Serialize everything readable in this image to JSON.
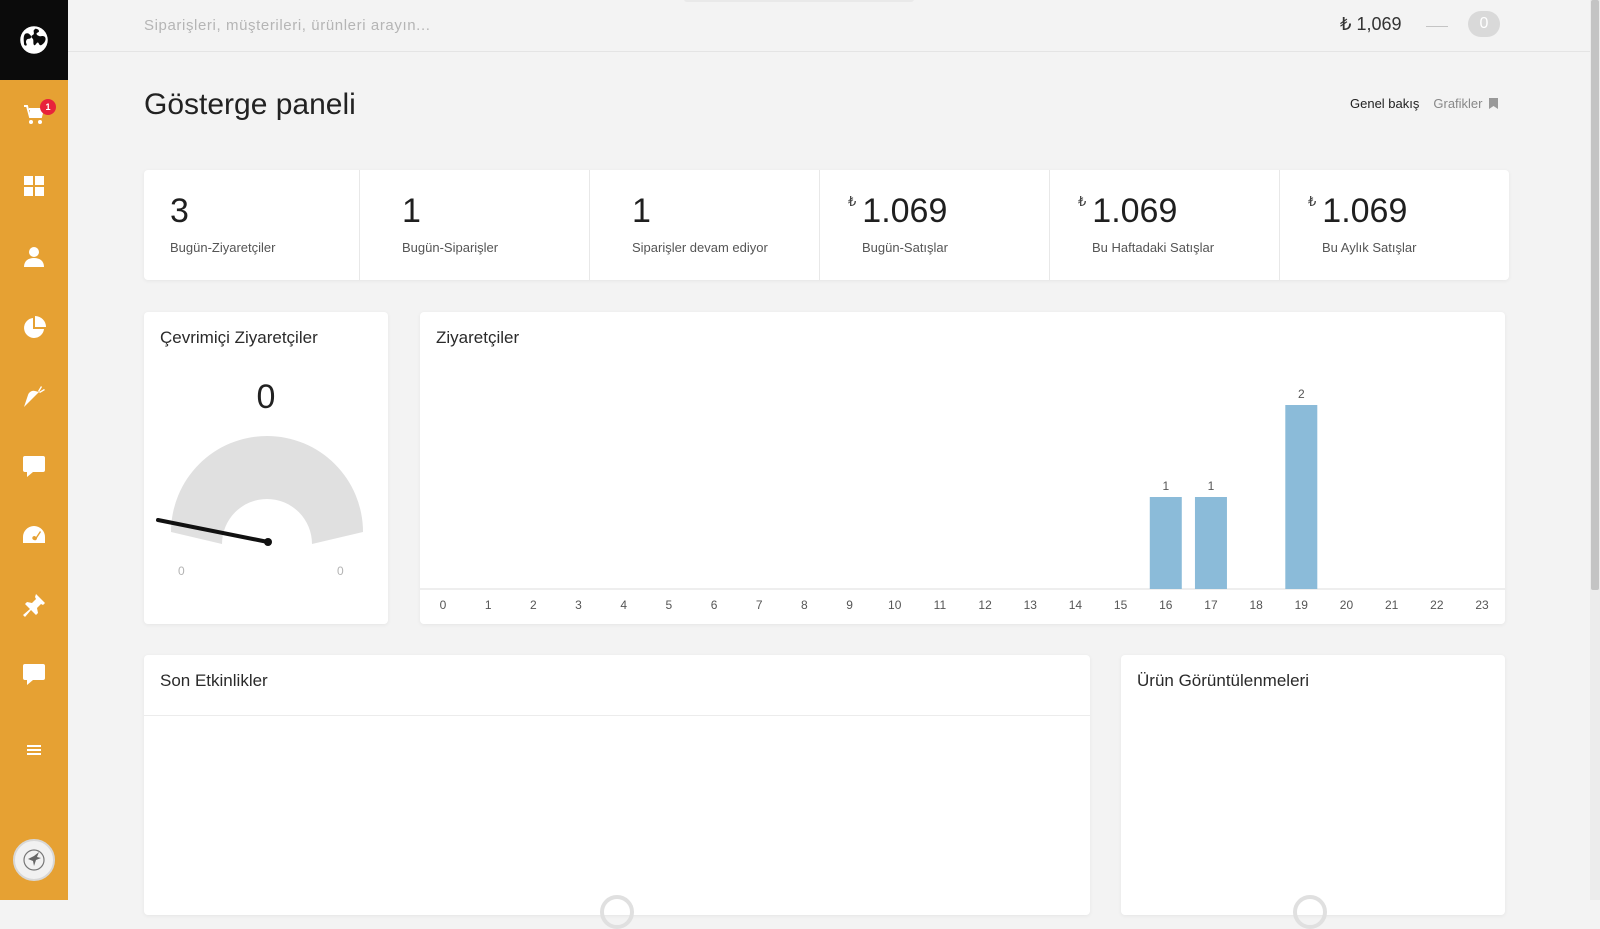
{
  "sidebar": {
    "cart_badge": "1",
    "items": [
      {
        "icon": "shopping-cart-icon"
      },
      {
        "icon": "dashboard-grid-icon"
      },
      {
        "icon": "user-icon"
      },
      {
        "icon": "pie-chart-icon"
      },
      {
        "icon": "carrot-icon"
      },
      {
        "icon": "comment-icon"
      },
      {
        "icon": "speedometer-icon"
      },
      {
        "icon": "pin-icon"
      },
      {
        "icon": "chat-icon"
      },
      {
        "icon": "menu-icon"
      }
    ]
  },
  "topbar": {
    "search_placeholder": "Siparişleri, müşterileri, ürünleri arayın...",
    "balance": "₺ 1,069",
    "notification_count": "0"
  },
  "page": {
    "title": "Gösterge paneli",
    "tabs": {
      "overview": "Genel bakış",
      "charts": "Grafikler"
    }
  },
  "stats": [
    {
      "value": "3",
      "currency": "",
      "label": "Bugün-Ziyaretçiler"
    },
    {
      "value": "1",
      "currency": "",
      "label": "Bugün-Siparişler"
    },
    {
      "value": "1",
      "currency": "",
      "label": "Siparişler devam ediyor"
    },
    {
      "value": "1.069",
      "currency": "₺",
      "label": "Bugün-Satışlar"
    },
    {
      "value": "1.069",
      "currency": "₺",
      "label": "Bu Haftadaki Satışlar"
    },
    {
      "value": "1.069",
      "currency": "₺",
      "label": "Bu Aylık Satışlar"
    }
  ],
  "online_visitors": {
    "title": "Çevrimiçi Ziyaretçiler",
    "value": "0",
    "min_label": "0",
    "max_label": "0",
    "gauge_level": 0
  },
  "visitors_chart": {
    "title": "Ziyaretçiler"
  },
  "recent_activity": {
    "title": "Son Etkinlikler"
  },
  "product_views": {
    "title": "Ürün Görüntülenmeleri"
  },
  "colors": {
    "sidebar": "#e6a133",
    "bar": "#8bbbd9",
    "badge": "#e8223b"
  },
  "chart_data": {
    "type": "bar",
    "categories": [
      "0",
      "1",
      "2",
      "3",
      "4",
      "5",
      "6",
      "7",
      "8",
      "9",
      "10",
      "11",
      "12",
      "13",
      "14",
      "15",
      "16",
      "17",
      "18",
      "19",
      "20",
      "21",
      "22",
      "23"
    ],
    "values": [
      0,
      0,
      0,
      0,
      0,
      0,
      0,
      0,
      0,
      0,
      0,
      0,
      0,
      0,
      0,
      0,
      1,
      1,
      0,
      2,
      0,
      0,
      0,
      0
    ],
    "title": "Ziyaretçiler",
    "xlabel": "",
    "ylabel": "",
    "ylim": [
      0,
      2
    ],
    "data_labels": true,
    "grid": false
  }
}
